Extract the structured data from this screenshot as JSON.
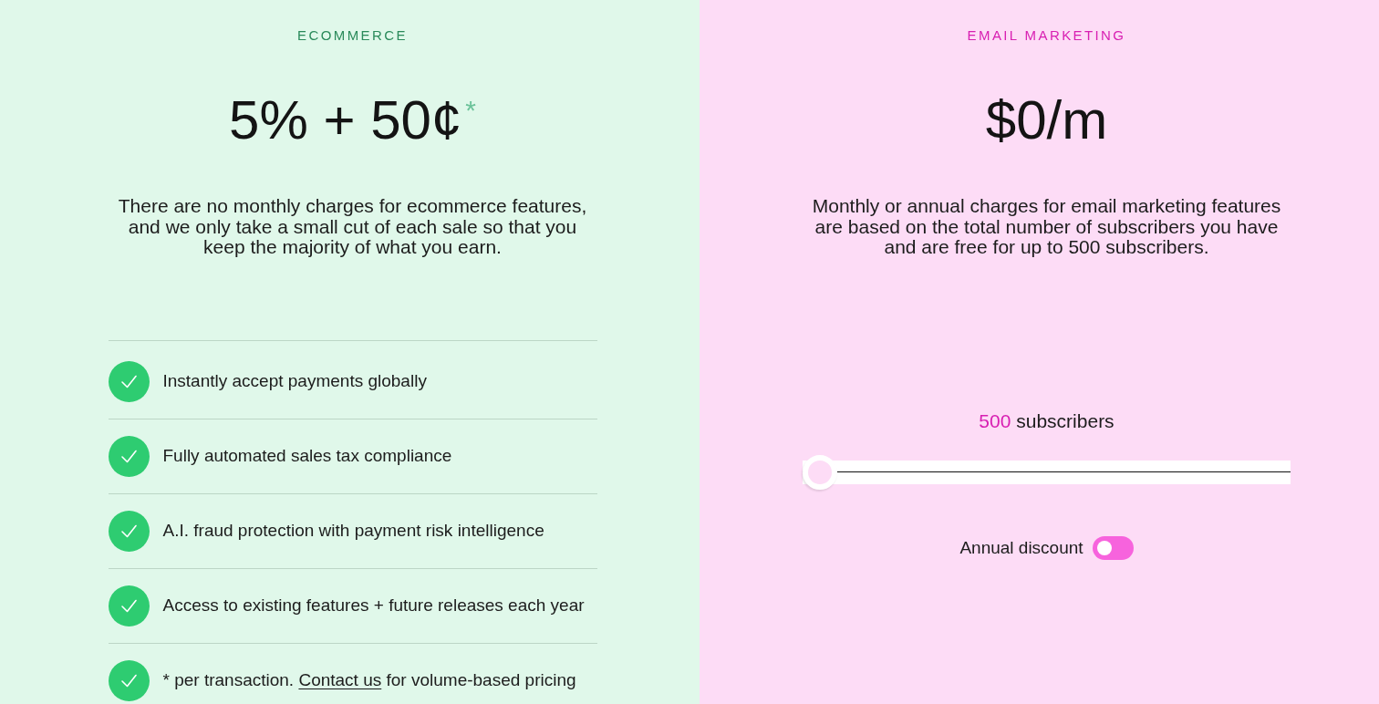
{
  "ecommerce": {
    "label": "ECOMMERCE",
    "price": "5% + 50¢",
    "price_mark": "*",
    "description": "There are no monthly charges for ecommerce features, and we only take a small cut of each sale so that you keep the majority of what you earn.",
    "features": [
      {
        "text": "Instantly accept payments globally"
      },
      {
        "text": "Fully automated sales tax compliance"
      },
      {
        "text": "A.I. fraud protection with payment risk intelligence"
      },
      {
        "text": "Access to existing features + future releases each year"
      },
      {
        "text": "* per transaction.",
        "link": "Contact us",
        "after": "for volume-based pricing"
      }
    ]
  },
  "email_marketing": {
    "label": "EMAIL MARKETING",
    "price": "$0/m",
    "description": "Monthly or annual charges for email marketing features are based on the total number of subscribers you have and are free for up to 500 subscribers.",
    "subscribers": {
      "count": "500",
      "unit": "subscribers",
      "level": 0
    },
    "annual_discount": {
      "label": "Annual discount",
      "on": false
    }
  }
}
